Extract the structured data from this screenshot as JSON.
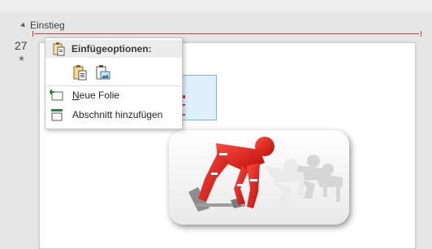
{
  "section": {
    "title": "Einstieg"
  },
  "slide": {
    "number": "27",
    "star": "★"
  },
  "context_menu": {
    "header": "Einfügeoptionen:",
    "items": [
      {
        "label_underlined": "N",
        "label_rest": "eue Folie",
        "icon": "new-slide-icon"
      },
      {
        "label_underlined": "",
        "label_rest": "Abschnitt hinzufügen",
        "icon": "add-section-icon"
      }
    ],
    "paste_options": [
      {
        "icon": "paste-keep-formatting-icon"
      },
      {
        "icon": "paste-as-picture-icon"
      }
    ]
  },
  "colors": {
    "accent_red": "#d33b3b",
    "figure_red": "#e0302a",
    "menu_bg": "#ffffff",
    "menu_header_bg": "#ececec"
  }
}
